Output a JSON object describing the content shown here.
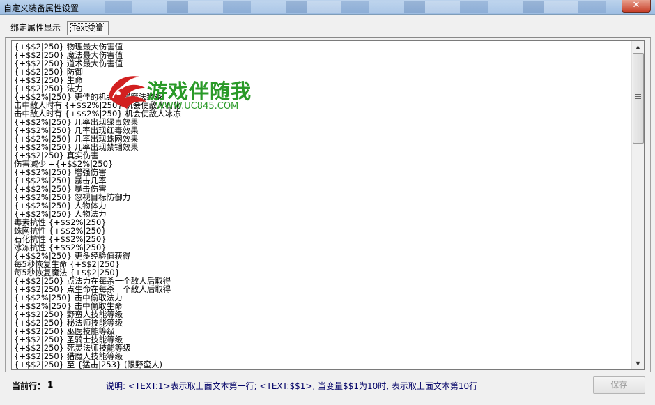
{
  "window": {
    "title": "自定义装备属性设置",
    "close_label": "✕"
  },
  "tabs": [
    {
      "label": "绑定属性显示"
    },
    {
      "label": "Text变量"
    }
  ],
  "editor_lines": [
    "{+$$2|250} 物理最大伤害值",
    "{+$$2|250} 魔法最大伤害值",
    "{+$$2|250} 道术最大伤害值",
    "{+$$2|250} 防御",
    "{+$$2|250} 生命",
    "{+$$2|250} 法力",
    "{+$$2%|250} 更佳的机会获得魔法装备",
    "击中敌人时有 {+$$2%|250} 机会使敌人石化",
    "击中敌人时有 {+$$2%|250} 机会使敌人冰冻",
    "{+$$2%|250} 几率出现绿毒效果",
    "{+$$2%|250} 几率出现红毒效果",
    "{+$$2%|250} 几率出现蛛网效果",
    "{+$$2%|250} 几率出现禁锢效果",
    "{+$$2|250} 真实伤害",
    "伤害减少 +{+$$2%|250}",
    "{+$$2%|250} 增强伤害",
    "{+$$2%|250} 暴击几率",
    "{+$$2%|250} 暴击伤害",
    "{+$$2%|250} 忽视目标防御力",
    "{+$$2%|250} 人物体力",
    "{+$$2%|250} 人物法力",
    "毒素抗性 {+$$2%|250}",
    "蛛网抗性 {+$$2%|250}",
    "石化抗性 {+$$2%|250}",
    "冰冻抗性 {+$$2%|250}",
    "{+$$2%|250} 更多经验值获得",
    "每5秒恢复生命 {+$$2|250}",
    "每5秒恢复魔法 {+$$2|250}",
    "{+$$2|250} 点法力在每杀一个敌人后取得",
    "{+$$2|250} 点生命在每杀一个敌人后取得",
    "{+$$2%|250} 击中偷取法力",
    "{+$$2%|250} 击中偷取生命",
    "{+$$2|250} 野蛮人技能等级",
    "{+$$2|250} 秘法师技能等级",
    "{+$$2|250} 巫医技能等级",
    "{+$$2|250} 圣骑士技能等级",
    "{+$$2|250} 死灵法师技能等级",
    "{+$$2|250} 猎魔人技能等级",
    "{+$$2|250} 至 {猛击|253} (限野蛮人)"
  ],
  "watermark": {
    "name": "游戏伴随我",
    "url": "WWW.UC845.COM"
  },
  "status": {
    "current_line_label": "当前行：",
    "current_line_value": "1",
    "hint": "说明: <TEXT:1>表示取上面文本第一行; <TEXT:$$1>, 当变量$$1为10时, 表示取上面文本第10行"
  },
  "buttons": {
    "save": "保存"
  },
  "colors": {
    "watermark_green": "#2a9a28",
    "hint_text": "#000066"
  }
}
